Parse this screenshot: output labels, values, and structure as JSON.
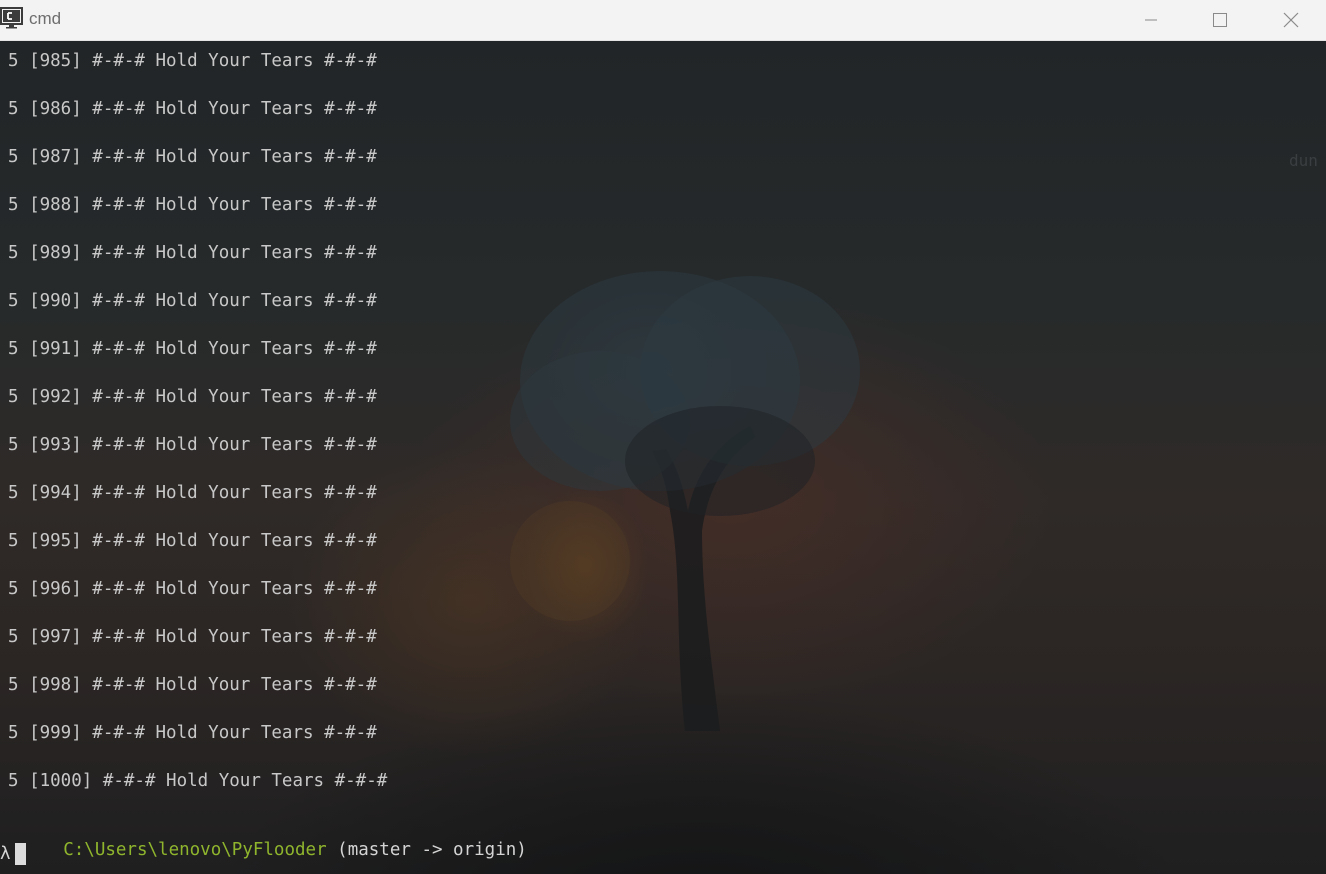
{
  "window": {
    "title": "cmd",
    "controls": [
      "minimize",
      "maximize",
      "close"
    ]
  },
  "background_fragment": "dun",
  "output": {
    "lines": [
      "5 [985] #-#-# Hold Your Tears #-#-#",
      "5 [986] #-#-# Hold Your Tears #-#-#",
      "5 [987] #-#-# Hold Your Tears #-#-#",
      "5 [988] #-#-# Hold Your Tears #-#-#",
      "5 [989] #-#-# Hold Your Tears #-#-#",
      "5 [990] #-#-# Hold Your Tears #-#-#",
      "5 [991] #-#-# Hold Your Tears #-#-#",
      "5 [992] #-#-# Hold Your Tears #-#-#",
      "5 [993] #-#-# Hold Your Tears #-#-#",
      "5 [994] #-#-# Hold Your Tears #-#-#",
      "5 [995] #-#-# Hold Your Tears #-#-#",
      "5 [996] #-#-# Hold Your Tears #-#-#",
      "5 [997] #-#-# Hold Your Tears #-#-#",
      "5 [998] #-#-# Hold Your Tears #-#-#",
      "5 [999] #-#-# Hold Your Tears #-#-#",
      "5 [1000] #-#-# Hold Your Tears #-#-#"
    ]
  },
  "prompt": {
    "path": "C:\\Users\\lenovo\\PyFlooder",
    "branch": " (master -> origin)",
    "symbol": "λ",
    "input": ""
  },
  "colors": {
    "path": "#8fb52d",
    "text": "#c8c8c8",
    "titlebar": "#f3f3f3"
  },
  "icons": {
    "app": "terminal-icon",
    "minimize": "minimize-icon",
    "maximize": "maximize-icon",
    "close": "close-icon"
  }
}
